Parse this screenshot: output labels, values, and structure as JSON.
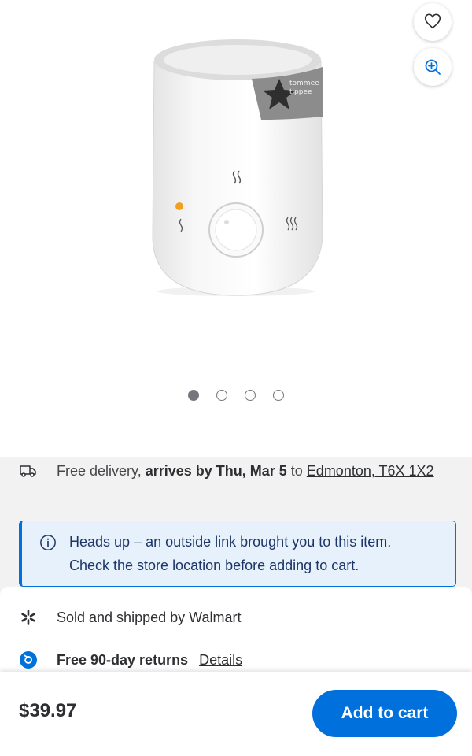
{
  "hero": {
    "image_alt": "Tommee Tippee bottle warmer, white",
    "brand_logo_text": "tommee tippee",
    "carousel": {
      "total": 4,
      "active_index": 0
    },
    "favorite_icon": "heart-icon",
    "zoom_icon": "zoom-in-icon"
  },
  "delivery": {
    "prefix": "Free delivery, ",
    "arrives": "arrives by Thu, Mar 5",
    "to": " to ",
    "location": "Edmonton, T6X 1X2"
  },
  "notice": {
    "line1": "Heads up – an outside link brought you to this item.",
    "line2": "Check the store location before adding to cart."
  },
  "seller": {
    "text": "Sold and shipped by Walmart"
  },
  "returns": {
    "text": "Free 90-day returns",
    "details_label": "Details"
  },
  "buy": {
    "price": "$39.97",
    "add_to_cart_label": "Add to cart"
  },
  "colors": {
    "accent": "#0071dc",
    "banner_bg": "#e6f1fc",
    "walmart_spark": "#2e2f32"
  }
}
